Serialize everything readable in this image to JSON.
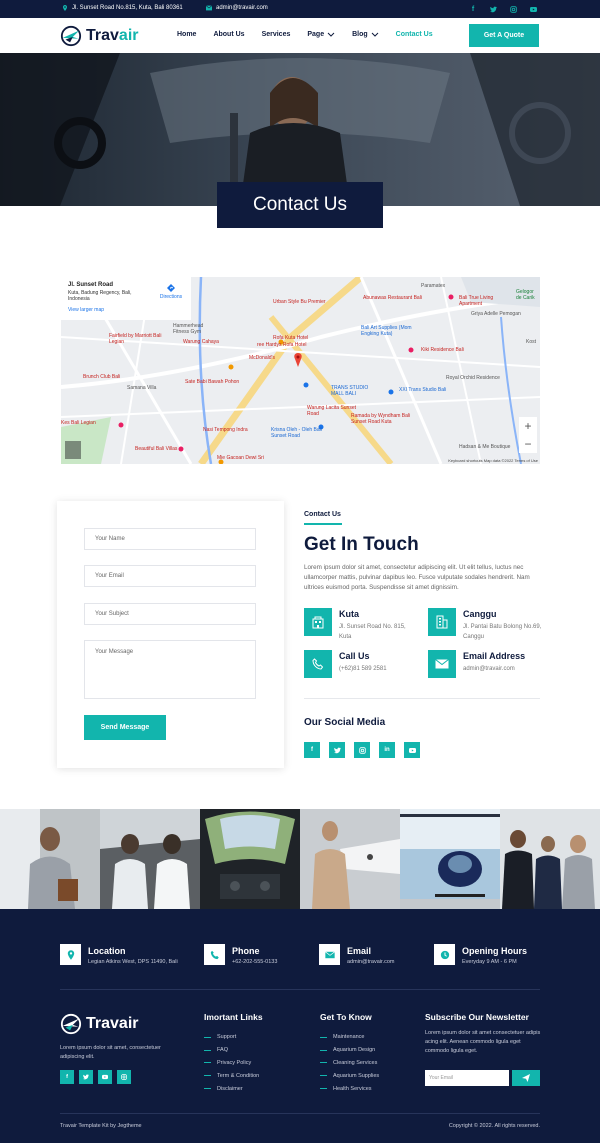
{
  "topbar": {
    "address": "Jl. Sunset Road No.815, Kuta, Bali 80361",
    "email": "admin@travair.com",
    "social": [
      "facebook-icon",
      "twitter-icon",
      "instagram-icon",
      "youtube-icon"
    ]
  },
  "nav": {
    "brand_a": "Trav",
    "brand_b": "air",
    "items": [
      "Home",
      "About Us",
      "Services",
      "Page",
      "Blog",
      "Contact Us"
    ],
    "cta": "Get A Quote"
  },
  "hero": {
    "title": "Contact Us"
  },
  "map": {
    "place": "Jl. Sunset Road",
    "place_addr": "Kuta, Badung Regency, Bali, Indonesia",
    "directions": "Directions",
    "larger": "View larger map",
    "labels": {
      "urban": "Urban Style Bu Premier",
      "abunawas": "Abunawas Restaurant Bali",
      "paramatex": "Paramatex",
      "gelogor": "Gelogor de Carik",
      "balitrue": "Bali True Living Apartment",
      "griya": "Griya Adelle Pemogan",
      "hammerhead": "Hammerhead Fitness Gym",
      "fairfield": "Fairfield by Marriott Bali Legian",
      "warung": "Warung Cahaya",
      "rofa": "Rofa Kuta Hotel",
      "hardys": "ree Hardys Rofa Hotel",
      "mcd": "McDonald's",
      "baliart": "Bali Art Supplies (Mom Engking Kuta)",
      "kiki": "Kiki Residence Bali",
      "brunch": "Brunch Club Bali",
      "samana": "Samana Villa",
      "satebabi": "Sate Babi Bawah Pohon",
      "transstudio": "TRANS STUDIO MALL BALI",
      "xxi": "XXI Trans Studio Bali",
      "royal": "Royal Orchid Residence",
      "warunglocal": "Warung Lacita Sunset Road",
      "ramada": "Ramada by Wyndham Bali Sunset Road Kuta",
      "kesbali": "Kes Bali Legian",
      "nasitempong": "Nasi Tempong Indra",
      "krisna": "Krisna Oleh - Oleh Bali Sunset Road",
      "beautiful": "Beautiful Bali Villas",
      "miegacoan": "Mie Gacoan Dewi Sri",
      "hadsan": "Hadsan & Me Boutique",
      "kosta": "Kost",
      "footer": "Keyboard shortcuts   Map data ©2022   Terms of Use"
    }
  },
  "form": {
    "name_ph": "Your Name",
    "email_ph": "Your Email",
    "subject_ph": "Your Subject",
    "message_ph": "Your Message",
    "send": "Send Message"
  },
  "contact": {
    "kicker": "Contact Us",
    "title": "Get In Touch",
    "para": "Lorem ipsum dolor sit amet, consectetur adipiscing elit. Ut elit tellus, luctus nec ullamcorper mattis, pulvinar dapibus leo. Fusce vulputate sodales hendrerit. Nam ultrices euismod porta. Suspendisse sit amet dignissim.",
    "items": [
      {
        "title": "Kuta",
        "detail": "Jl. Sunset Road No. 815, Kuta"
      },
      {
        "title": "Canggu",
        "detail": "Jl. Pantai Batu Bolong No.69, Canggu"
      },
      {
        "title": "Call Us",
        "detail": "(+62)81 589 2581"
      },
      {
        "title": "Email Address",
        "detail": "admin@travair.com"
      }
    ],
    "social_title": "Our Social Media",
    "social": [
      "f",
      "t",
      "ig",
      "in",
      "yt"
    ]
  },
  "footer": {
    "info": [
      {
        "title": "Location",
        "detail": "Legian Atkins West, DPS 11490, Bali"
      },
      {
        "title": "Phone",
        "detail": "+62-202-555-0133"
      },
      {
        "title": "Email",
        "detail": "admin@travair.com"
      },
      {
        "title": "Opening Hours",
        "detail": "Everyday 9 AM - 6 PM"
      }
    ],
    "brand": "Travair",
    "desc": "Lorem ipsum dolor sit amet, consectetuer adipiscing elit.",
    "social": [
      "f",
      "t",
      "yt",
      "ig"
    ],
    "links_title": "Imortant Links",
    "links": [
      "Support",
      "FAQ",
      "Privacy Policy",
      "Term & Condition",
      "Disclaimer"
    ],
    "know_title": "Get To Know",
    "know": [
      "Maintenance",
      "Aquarium Design",
      "Cleaning Services",
      "Aquarium Supplies",
      "Health Services"
    ],
    "news_title": "Subscribe Our Newsletter",
    "news_desc": "Lorem ipsum dolor sit amet consectetuer adipis acing elit. Aenean commodo ligula eget commodo ligula eget.",
    "news_ph": "Your Email",
    "credit": "Travair Template Kit by Jegtheme",
    "copyright": "Copyright © 2022. All rights reserved."
  },
  "colors": {
    "accent": "#12b5ad",
    "navy": "#0f1b3d"
  }
}
